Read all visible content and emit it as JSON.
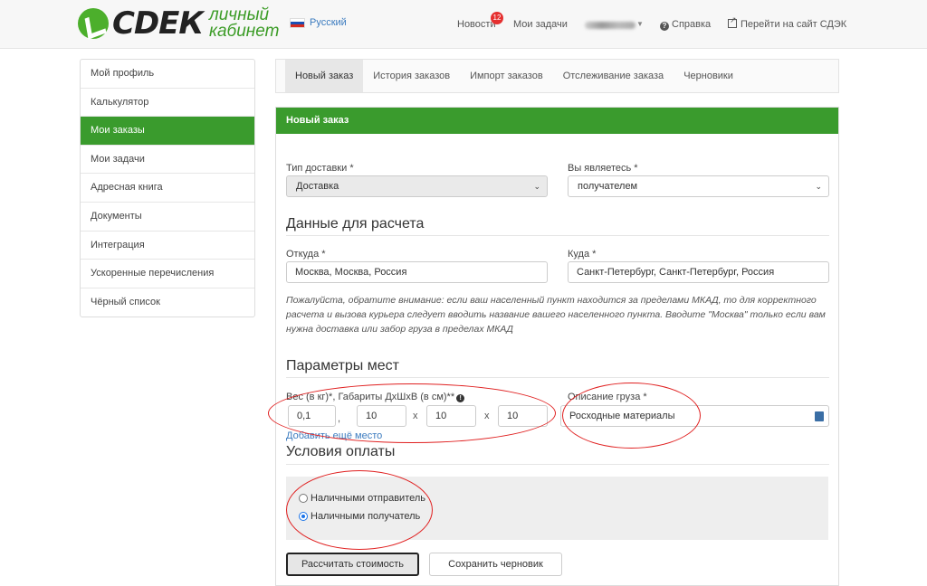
{
  "header": {
    "logo_text": "СDЕК",
    "logo_sub_line1": "личный",
    "logo_sub_line2": "кабинет",
    "lang": "Русский",
    "news": "Новости",
    "news_badge": "12",
    "tasks": "Мои задачи",
    "help": "Справка",
    "go_site": "Перейти на сайт СДЭК"
  },
  "sidebar": {
    "items": [
      {
        "label": "Мой профиль"
      },
      {
        "label": "Калькулятор"
      },
      {
        "label": "Мои заказы",
        "active": true
      },
      {
        "label": "Мои задачи"
      },
      {
        "label": "Адресная книга"
      },
      {
        "label": "Документы"
      },
      {
        "label": "Интеграция"
      },
      {
        "label": "Ускоренные перечисления"
      },
      {
        "label": "Чёрный список"
      }
    ]
  },
  "tabs": [
    {
      "label": "Новый заказ",
      "active": true
    },
    {
      "label": "История заказов"
    },
    {
      "label": "Импорт заказов"
    },
    {
      "label": "Отслеживание заказа"
    },
    {
      "label": "Черновики"
    }
  ],
  "form": {
    "panel_title": "Новый заказ",
    "delivery_type_label": "Тип доставки *",
    "delivery_type_value": "Доставка",
    "you_are_label": "Вы являетесь *",
    "you_are_value": "получателем",
    "calc_heading": "Данные для расчета",
    "from_label": "Откуда *",
    "from_value": "Москва, Москва, Россия",
    "to_label": "Куда *",
    "to_value": "Санкт-Петербург, Санкт-Петербург, Россия",
    "note": "Пожалуйста, обратите внимание: если ваш населенный пункт находится за пределами МКАД, то для корректного расчета и вызова курьера следует вводить название вашего населенного пункта. Вводите \"Москва\" только если вам нужна доставка или забор груза в пределах МКАД",
    "places_heading": "Параметры мест",
    "weight_label": "Вес (в кг)*, Габариты ДхШхВ (в см)**",
    "weight_value": "0,1",
    "sep_comma": ",",
    "length_value": "10",
    "sep_x1": "x",
    "width_value": "10",
    "sep_x2": "x",
    "height_value": "10",
    "cargo_label": "Описание груза *",
    "cargo_value": "Росходные материалы",
    "add_place": "Добавить ещё место",
    "payment_heading": "Условия оплаты",
    "pay_option1": "Наличными отправитель",
    "pay_option2": "Наличными получатель",
    "pay_selected": 2,
    "calc_button": "Рассчитать стоимость",
    "draft_button": "Сохранить черновик"
  },
  "colors": {
    "brand_green": "#3a9b2d",
    "link_blue": "#3b7bbf",
    "annotation_red": "#e02020"
  }
}
